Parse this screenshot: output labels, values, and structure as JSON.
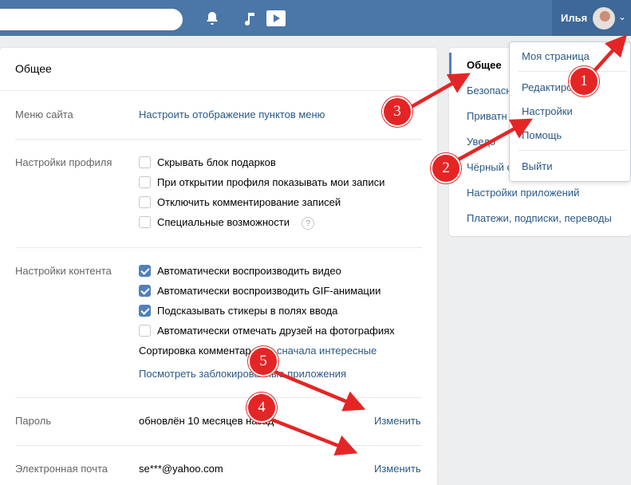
{
  "topbar": {
    "search_placeholder": "",
    "user_name": "Илья",
    "icons": [
      "bell-icon",
      "music-icon",
      "video-icon",
      "chevron-down-icon"
    ],
    "color": "#4a76a8"
  },
  "main": {
    "title": "Общее",
    "menu": {
      "label": "Меню сайта",
      "link": "Настроить отображение пунктов меню"
    },
    "profile": {
      "label": "Настройки профиля",
      "options": [
        {
          "text": "Скрывать блок подарков",
          "checked": false
        },
        {
          "text": "При открытии профиля показывать мои записи",
          "checked": false
        },
        {
          "text": "Отключить комментирование записей",
          "checked": false
        },
        {
          "text": "Специальные возможности",
          "checked": false
        }
      ],
      "help": "?"
    },
    "content": {
      "label": "Настройки контента",
      "options": [
        {
          "text": "Автоматически воспроизводить видео",
          "checked": true
        },
        {
          "text": "Автоматически воспроизводить GIF-анимации",
          "checked": true
        },
        {
          "text": "Подсказывать стикеры в полях ввода",
          "checked": true
        },
        {
          "text": "Автоматически отмечать друзей на фотографиях",
          "checked": false
        }
      ],
      "sort_prefix": "Сортировка комментар",
      "sort_value": "сначала интересные",
      "blocked_apps": "Посмотреть заблокированные приложения"
    },
    "password": {
      "label": "Пароль",
      "value": "обновлён 10 месяцев назад",
      "action": "Изменить"
    },
    "email": {
      "label": "Электронная почта",
      "value": "se***@yahoo.com",
      "action": "Изменить"
    }
  },
  "side": {
    "items": [
      {
        "label": "Общее",
        "active": true
      },
      {
        "label": "Безопасн"
      },
      {
        "label": "Приватн"
      },
      {
        "label": "Уведо"
      },
      {
        "label": "Чёрный с"
      },
      {
        "label": "Настройки приложений"
      },
      {
        "label": "Платежи, подписки, переводы"
      }
    ]
  },
  "dropdown": {
    "items": [
      "Моя страница",
      "Редактиро",
      "Настройки",
      "Помощь",
      "Выйти"
    ]
  },
  "annotations": {
    "badges": [
      "1",
      "2",
      "3",
      "4",
      "5"
    ],
    "color": "#e52525"
  }
}
